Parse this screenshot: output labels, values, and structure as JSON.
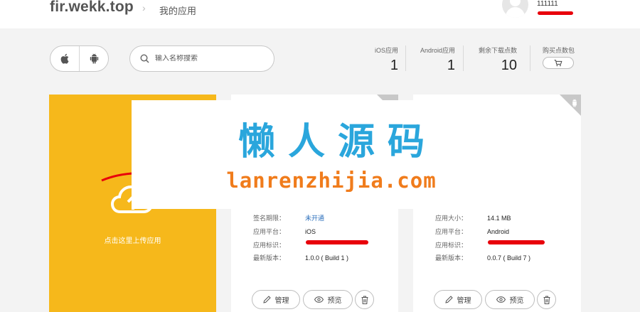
{
  "header": {
    "brand": "fir.wekk.top",
    "crumb_sep": "›",
    "current_page": "我的应用",
    "username": "111111"
  },
  "toolbar": {
    "platforms": [
      "apple-icon",
      "android-icon"
    ],
    "search_placeholder": "输入名称搜索"
  },
  "stats": [
    {
      "label": "iOS应用",
      "value": "1"
    },
    {
      "label": "Android应用",
      "value": "1"
    },
    {
      "label": "剩余下载点数",
      "value": "10"
    },
    {
      "label": "购买点数包",
      "icon": "cart-icon"
    }
  ],
  "upload_card": {
    "label": "点击这里上传应用",
    "color": "#f6b81b"
  },
  "apps": [
    {
      "platform": "iOS",
      "rows": [
        {
          "key": "签名期限：",
          "value": "未开通"
        },
        {
          "key": "应用平台：",
          "value": "iOS"
        },
        {
          "key": "应用标识：",
          "value": ""
        },
        {
          "key": "最新版本：",
          "value": "1.0.0 ( Build 1 )"
        }
      ],
      "buttons": {
        "manage": "管理",
        "preview": "预览"
      }
    },
    {
      "platform": "Android",
      "rows": [
        {
          "key": "应用大小：",
          "value": "14.1 MB"
        },
        {
          "key": "应用平台：",
          "value": "Android"
        },
        {
          "key": "应用标识：",
          "value": ""
        },
        {
          "key": "最新版本：",
          "value": "0.0.7 ( Build 7 )"
        }
      ],
      "buttons": {
        "manage": "管理",
        "preview": "预览"
      }
    }
  ],
  "watermark": {
    "title": "懒人源码",
    "subtitle": "lanrenzhijia.com"
  },
  "colors": {
    "accent_blue": "#2aa6dc",
    "accent_orange": "#f07c1c",
    "redaction": "#e8000b"
  }
}
